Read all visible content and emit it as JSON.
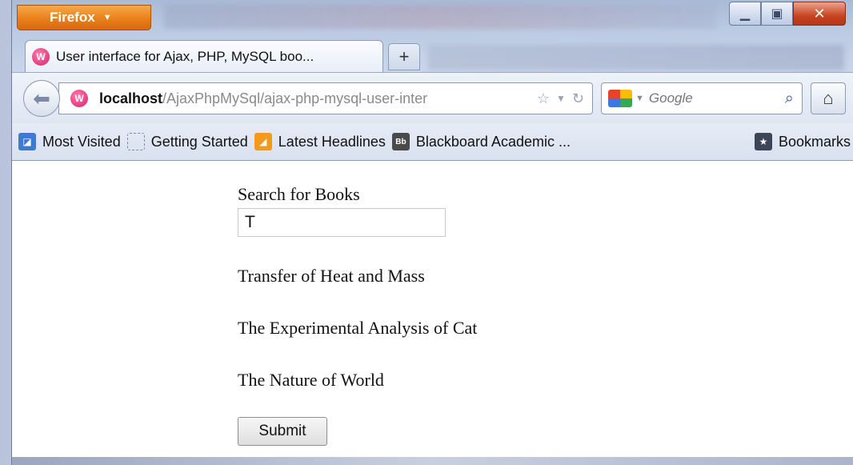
{
  "browser": {
    "menu_label": "Firefox",
    "tab_title": "User interface for Ajax, PHP, MySQL boo...",
    "favicon_glyph": "W",
    "new_tab_label": "+",
    "url_host": "localhost",
    "url_path": "/AjaxPhpMySql/ajax-php-mysql-user-inter",
    "search_placeholder": "Google"
  },
  "bookmarks": {
    "items": [
      {
        "label": "Most Visited",
        "icon": "most-visited-icon"
      },
      {
        "label": "Getting Started",
        "icon": "getting-started-icon"
      },
      {
        "label": "Latest Headlines",
        "icon": "rss-feed-icon"
      },
      {
        "label": "Blackboard Academic ...",
        "icon": "blackboard-icon"
      }
    ],
    "menu_label": "Bookmarks",
    "blackboard_glyph": "Bb"
  },
  "page": {
    "search_label": "Search for Books",
    "search_value": "T",
    "results": [
      "Transfer of Heat and Mass",
      "The Experimental Analysis of Cat",
      "The Nature of World"
    ],
    "submit_label": "Submit"
  },
  "colors": {
    "firefox_button": "#e9801b",
    "favicon": "#d6226a",
    "close_button": "#c7441f"
  }
}
